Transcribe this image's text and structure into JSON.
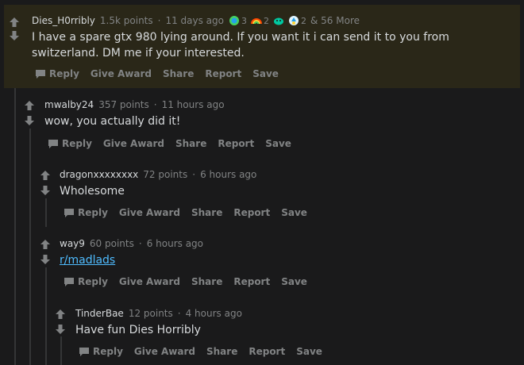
{
  "comments": [
    {
      "author": "Dies_H0rribly",
      "points": "1.5k points",
      "time": "11 days ago",
      "awards": [
        {
          "icon": "hugz-award-icon",
          "count": "3"
        },
        {
          "icon": "rainbow-award-icon",
          "count": "2"
        },
        {
          "icon": "wholesome-award-icon",
          "count": ""
        },
        {
          "icon": "take-my-energy-award-icon",
          "count": "2"
        }
      ],
      "more_awards": "& 56 More",
      "body": "I have a spare gtx 980 lying around. If you want it i can send it to you from switzerland. DM me if your interested."
    },
    {
      "author": "mwalby24",
      "points": "357 points",
      "time": "11 hours ago",
      "body": "wow, you actually did it!"
    },
    {
      "author": "dragonxxxxxxxx",
      "points": "72 points",
      "time": "6 hours ago",
      "body": "Wholesome"
    },
    {
      "author": "way9",
      "points": "60 points",
      "time": "6 hours ago",
      "body": "r/madlads"
    },
    {
      "author": "TinderBae",
      "points": "12 points",
      "time": "4 hours ago",
      "body": "Have fun Dies Horribly"
    }
  ],
  "actions": {
    "reply": "Reply",
    "give_award": "Give Award",
    "share": "Share",
    "report": "Report",
    "save": "Save"
  },
  "separator": "·",
  "colors": {
    "background": "#1a1a1b",
    "highlight": "#2a2718",
    "text": "#d7dadc",
    "muted": "#818384",
    "link": "#4fbcff"
  }
}
